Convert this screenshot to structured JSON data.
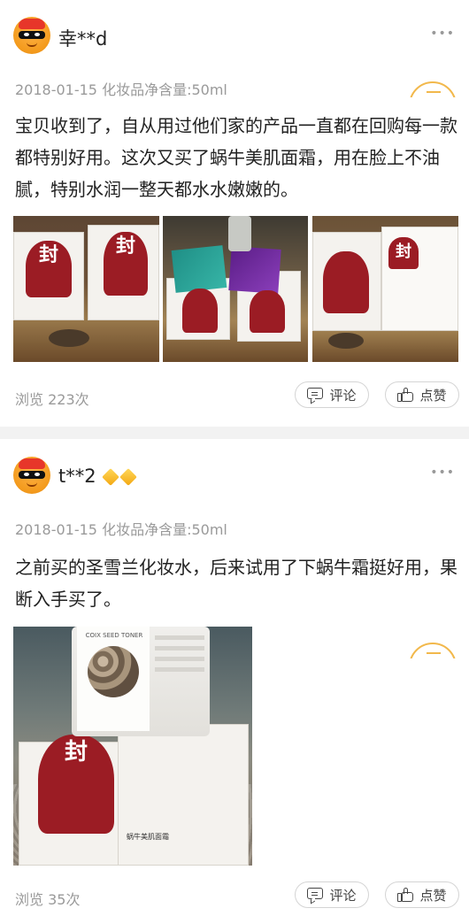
{
  "reviews": [
    {
      "username": "幸**d",
      "more": "•••",
      "date": "2018-01-15",
      "spec": "化妆品净含量:50ml",
      "text": "宝贝收到了，自从用过他们家的产品一直都在回购每一款都特别好用。这次又买了蜗牛美肌面霜，用在脸上不油腻，特别水润一整天都水水嫩嫩的。",
      "views": "浏览 223次",
      "comment_label": "评论",
      "like_label": "点赞",
      "photos": [
        "photo-sealed-boxes",
        "photo-boxes-with-sachets",
        "photo-box-side",
        "photo-box-back"
      ]
    },
    {
      "username": "t**2",
      "more": "•••",
      "date": "2018-01-15",
      "spec": "化妆品净含量:50ml",
      "text": "之前买的圣雪兰化妆水，后来试用了下蜗牛霜挺好用，果断入手买了。",
      "views": "浏览 35次",
      "comment_label": "评论",
      "like_label": "点赞",
      "photos": [
        "photo-toner-and-cream-boxes"
      ],
      "badges": [
        "diamond-icon",
        "diamond-icon"
      ]
    }
  ],
  "photo_text": {
    "seal_char": "封",
    "toner_name": "COIX SEED TONER",
    "cream_name": "蜗牛美肌面霜"
  },
  "colors": {
    "accent_gold": "#f2b84b",
    "seal_red": "#9b1c24",
    "meta_gray": "#9a9a9a"
  }
}
